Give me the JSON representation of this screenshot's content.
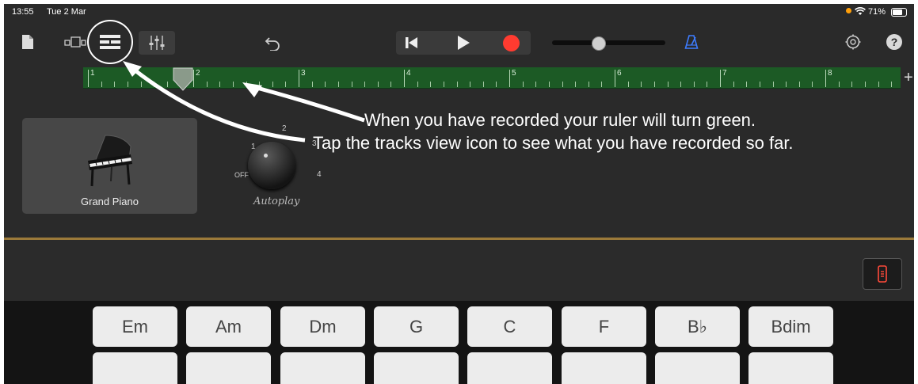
{
  "status": {
    "time": "13:55",
    "date": "Tue 2 Mar",
    "battery": "71%"
  },
  "ruler": {
    "bars": [
      "1",
      "2",
      "3",
      "4",
      "5",
      "6",
      "7",
      "8"
    ]
  },
  "track": {
    "name": "Grand Piano"
  },
  "autoplay": {
    "label": "Autoplay",
    "off": "OFF",
    "positions": [
      "1",
      "2",
      "3",
      "4"
    ]
  },
  "annotations": {
    "line1": "When you have recorded your ruler will turn green.",
    "line2": "Tap the tracks view icon to see what you have recorded so far."
  },
  "chords": [
    "Em",
    "Am",
    "Dm",
    "G",
    "C",
    "F",
    "B♭",
    "Bdim"
  ],
  "colors": {
    "record": "#ff3b30",
    "ruler": "#1c5a25",
    "accent": "#3d7cff",
    "wood": "#9b7a3a"
  },
  "icons": [
    "document-icon",
    "view-toggle-icon",
    "tracks-view-icon",
    "mixer-icon",
    "undo-icon",
    "rewind-icon",
    "play-icon",
    "record-icon",
    "metronome-icon",
    "settings-icon",
    "help-icon",
    "add-icon",
    "controller-icon",
    "piano-icon"
  ]
}
